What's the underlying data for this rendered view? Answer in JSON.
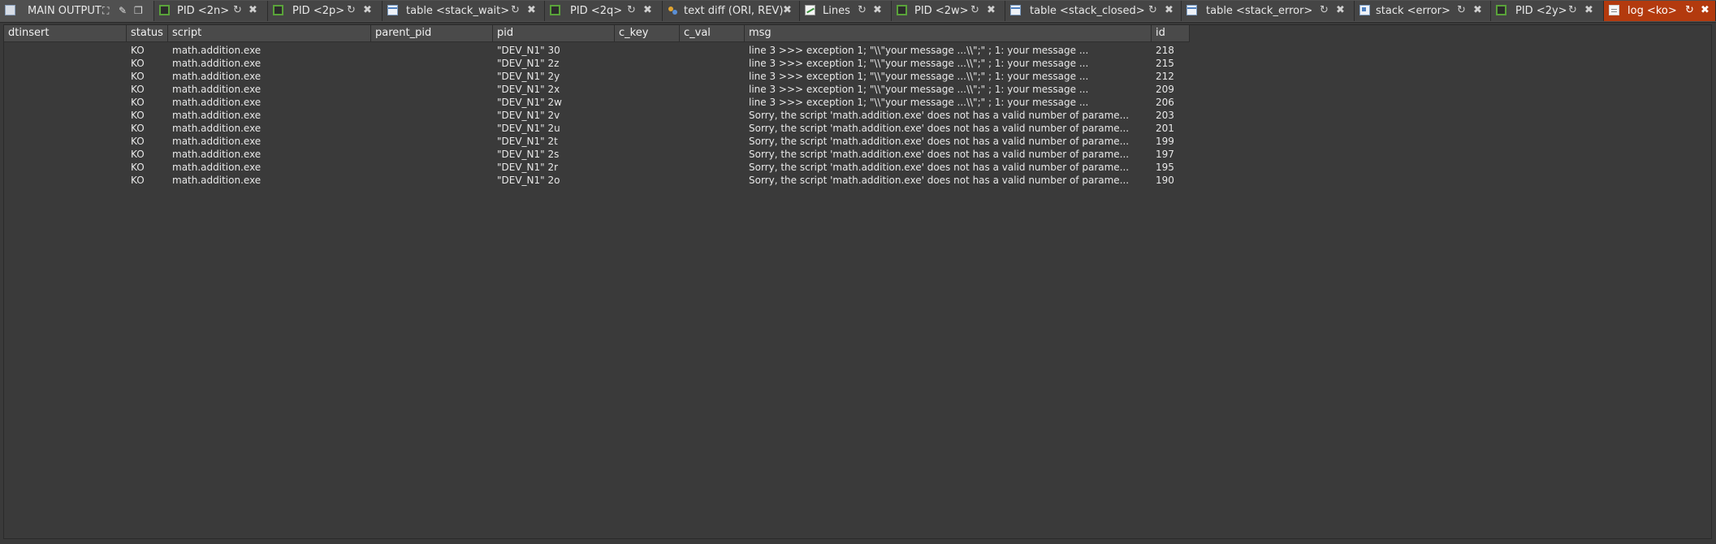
{
  "tabs": [
    {
      "label": "MAIN OUTPUT",
      "icon": "monitor-icon"
    },
    {
      "label": "PID <2n>",
      "icon": "process-icon"
    },
    {
      "label": "PID <2p>",
      "icon": "process-icon"
    },
    {
      "label": "table <stack_wait>",
      "icon": "table-icon"
    },
    {
      "label": "PID <2q>",
      "icon": "process-icon"
    },
    {
      "label": "text diff (ORI, REV)",
      "icon": "diff-icon"
    },
    {
      "label": "Lines",
      "icon": "lines-chart-icon"
    },
    {
      "label": "PID <2w>",
      "icon": "process-icon"
    },
    {
      "label": "table <stack_closed>",
      "icon": "table-icon"
    },
    {
      "label": "table <stack_error>",
      "icon": "table-icon"
    },
    {
      "label": "stack <error>",
      "icon": "stack-icon"
    },
    {
      "label": "PID <2y>",
      "icon": "process-icon"
    },
    {
      "label": "log <ko>",
      "icon": "log-icon",
      "active": true
    }
  ],
  "active_tab_color": "#b33a0e",
  "table": {
    "columns": [
      "dtinsert",
      "status",
      "script",
      "parent_pid",
      "pid",
      "c_key",
      "c_val",
      "msg",
      "id"
    ],
    "rows": [
      {
        "dtinsert": "",
        "status": "KO",
        "script": "math.addition.exe",
        "parent_pid": "",
        "pid": "\"DEV_N1\" 30",
        "c_key": "",
        "c_val": "",
        "msg": "line 3 >>> exception 1; \"\\\\\"your message ...\\\\\";\" ; 1: your message ...",
        "id": "218"
      },
      {
        "dtinsert": "",
        "status": "KO",
        "script": "math.addition.exe",
        "parent_pid": "",
        "pid": "\"DEV_N1\" 2z",
        "c_key": "",
        "c_val": "",
        "msg": "line 3 >>> exception 1; \"\\\\\"your message ...\\\\\";\" ; 1: your message ...",
        "id": "215"
      },
      {
        "dtinsert": "",
        "status": "KO",
        "script": "math.addition.exe",
        "parent_pid": "",
        "pid": "\"DEV_N1\" 2y",
        "c_key": "",
        "c_val": "",
        "msg": "line 3 >>> exception 1; \"\\\\\"your message ...\\\\\";\" ; 1: your message ...",
        "id": "212"
      },
      {
        "dtinsert": "",
        "status": "KO",
        "script": "math.addition.exe",
        "parent_pid": "",
        "pid": "\"DEV_N1\" 2x",
        "c_key": "",
        "c_val": "",
        "msg": "line 3 >>> exception 1; \"\\\\\"your message ...\\\\\";\" ; 1: your message ...",
        "id": "209"
      },
      {
        "dtinsert": "",
        "status": "KO",
        "script": "math.addition.exe",
        "parent_pid": "",
        "pid": "\"DEV_N1\" 2w",
        "c_key": "",
        "c_val": "",
        "msg": "line 3 >>> exception 1; \"\\\\\"your message ...\\\\\";\" ; 1: your message ...",
        "id": "206"
      },
      {
        "dtinsert": "",
        "status": "KO",
        "script": "math.addition.exe",
        "parent_pid": "",
        "pid": "\"DEV_N1\" 2v",
        "c_key": "",
        "c_val": "",
        "msg": "Sorry, the script 'math.addition.exe' does not has a valid number of parame...",
        "id": "203"
      },
      {
        "dtinsert": "",
        "status": "KO",
        "script": "math.addition.exe",
        "parent_pid": "",
        "pid": "\"DEV_N1\" 2u",
        "c_key": "",
        "c_val": "",
        "msg": "Sorry, the script 'math.addition.exe' does not has a valid number of parame...",
        "id": "201"
      },
      {
        "dtinsert": "",
        "status": "KO",
        "script": "math.addition.exe",
        "parent_pid": "",
        "pid": "\"DEV_N1\" 2t",
        "c_key": "",
        "c_val": "",
        "msg": "Sorry, the script 'math.addition.exe' does not has a valid number of parame...",
        "id": "199"
      },
      {
        "dtinsert": "",
        "status": "KO",
        "script": "math.addition.exe",
        "parent_pid": "",
        "pid": "\"DEV_N1\" 2s",
        "c_key": "",
        "c_val": "",
        "msg": "Sorry, the script 'math.addition.exe' does not has a valid number of parame...",
        "id": "197"
      },
      {
        "dtinsert": "",
        "status": "KO",
        "script": "math.addition.exe",
        "parent_pid": "",
        "pid": "\"DEV_N1\" 2r",
        "c_key": "",
        "c_val": "",
        "msg": "Sorry, the script 'math.addition.exe' does not has a valid number of parame...",
        "id": "195"
      },
      {
        "dtinsert": "",
        "status": "KO",
        "script": "math.addition.exe",
        "parent_pid": "",
        "pid": "\"DEV_N1\" 2o",
        "c_key": "",
        "c_val": "",
        "msg": "Sorry, the script 'math.addition.exe' does not has a valid number of parame...",
        "id": "190"
      }
    ]
  }
}
